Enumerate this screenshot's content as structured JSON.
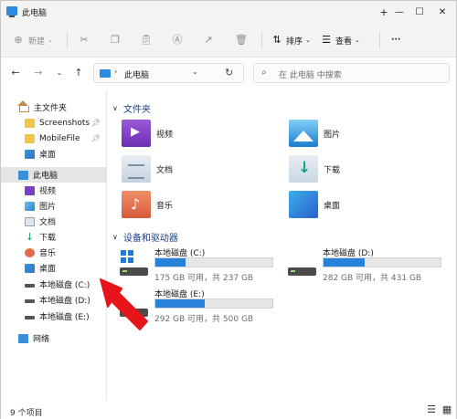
{
  "window": {
    "title": "此电脑",
    "controls": {
      "minimize": "—",
      "maximize": "☐",
      "close": "✕"
    }
  },
  "toolbar": {
    "new_label": "新建",
    "sort_label": "排序",
    "view_label": "查看",
    "more_label": "···"
  },
  "nav": {
    "address": "此电脑",
    "search_placeholder": "在 此电脑 中搜索"
  },
  "sidebar": {
    "items": [
      {
        "label": "主文件夹",
        "icon": "home-icon"
      },
      {
        "label": "Screenshots",
        "icon": "folder-icon",
        "pinned": true
      },
      {
        "label": "MobileFile",
        "icon": "folder-icon",
        "pinned": true
      },
      {
        "label": "桌面",
        "icon": "desktop-icon"
      },
      {
        "label": "此电脑",
        "icon": "pc-icon",
        "selected": true
      },
      {
        "label": "视频",
        "icon": "video-icon"
      },
      {
        "label": "图片",
        "icon": "pictures-icon"
      },
      {
        "label": "文档",
        "icon": "documents-icon"
      },
      {
        "label": "下载",
        "icon": "download-icon"
      },
      {
        "label": "音乐",
        "icon": "music-icon"
      },
      {
        "label": "桌面",
        "icon": "desktop-icon"
      },
      {
        "label": "本地磁盘 (C:)",
        "icon": "drive-icon"
      },
      {
        "label": "本地磁盘 (D:)",
        "icon": "drive-icon"
      },
      {
        "label": "本地磁盘 (E:)",
        "icon": "drive-icon"
      },
      {
        "label": "网络",
        "icon": "network-icon"
      }
    ]
  },
  "content": {
    "folders_header": "文件夹",
    "folders": [
      {
        "label": "视频",
        "icon": "video-folder-icon"
      },
      {
        "label": "图片",
        "icon": "pictures-folder-icon"
      },
      {
        "label": "文档",
        "icon": "documents-folder-icon"
      },
      {
        "label": "下载",
        "icon": "download-folder-icon"
      },
      {
        "label": "音乐",
        "icon": "music-folder-icon"
      },
      {
        "label": "桌面",
        "icon": "desktop-folder-icon"
      }
    ],
    "drives_header": "设备和驱动器",
    "drives": [
      {
        "name": "本地磁盘 (C:)",
        "free_total": "175 GB 可用，共 237 GB",
        "used_fraction": 0.26
      },
      {
        "name": "本地磁盘 (D:)",
        "free_total": "282 GB 可用，共 431 GB",
        "used_fraction": 0.35
      },
      {
        "name": "本地磁盘 (E:)",
        "free_total": "292 GB 可用，共 500 GB",
        "used_fraction": 0.42
      }
    ]
  },
  "status": {
    "item_count": "9 个项目"
  },
  "colors": {
    "accent": "#2683d9",
    "annotation_arrow": "#e8141b"
  }
}
